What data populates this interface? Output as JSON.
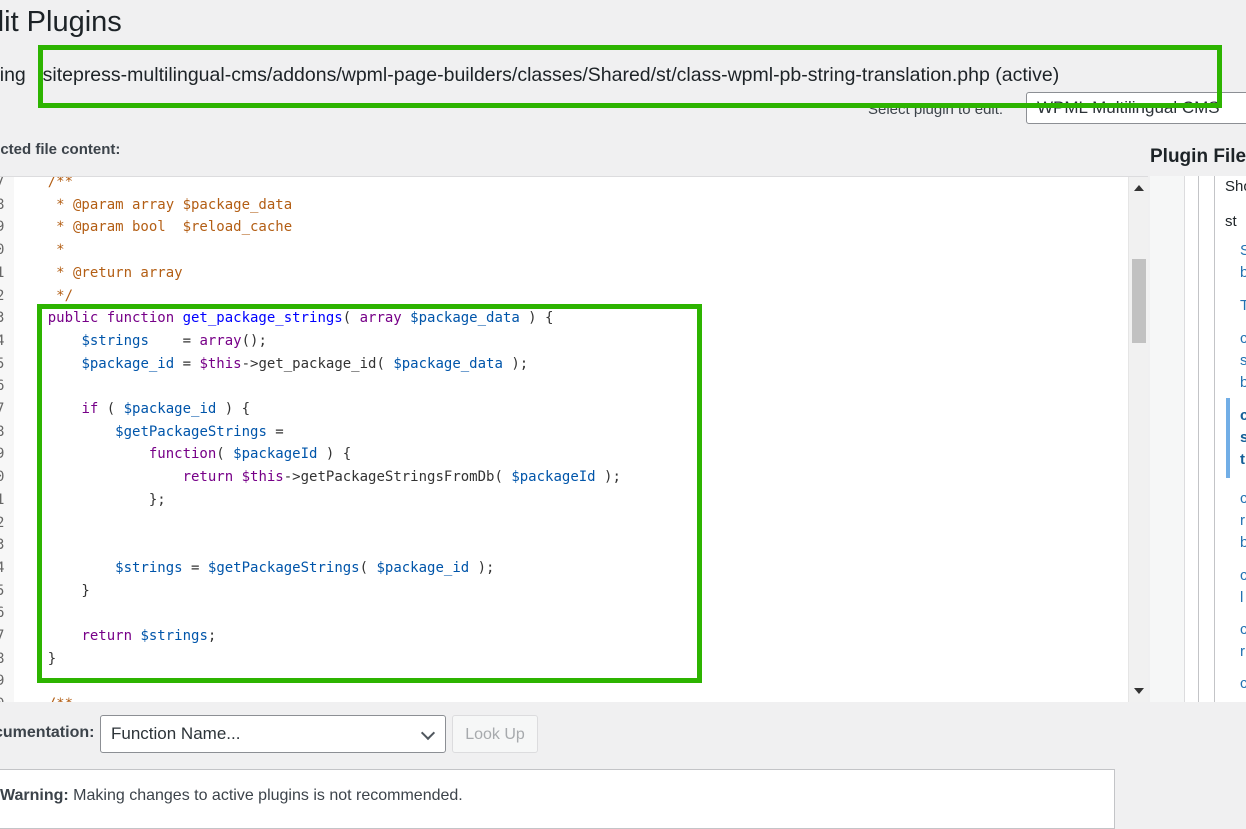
{
  "page_title": "dit Plugins",
  "editing": {
    "prefix": "iting",
    "file_path": "sitepress-multilingual-cms/addons/wpml-page-builders/classes/Shared/st/class-wpml-pb-string-translation.php",
    "status": "(active)"
  },
  "plugin_select": {
    "label": "Select plugin to edit:",
    "value": "WPML Multilingual CMS"
  },
  "selected_file_label": "ected file content:",
  "plugin_files_title": "Plugin File",
  "code_lines": [
    {
      "n": "7",
      "tokens": [
        {
          "t": "    /**",
          "c": "cm"
        }
      ]
    },
    {
      "n": "8",
      "tokens": [
        {
          "t": "     * @param array $package_data",
          "c": "cm"
        }
      ]
    },
    {
      "n": "9",
      "tokens": [
        {
          "t": "     * @param bool  $reload_cache",
          "c": "cm"
        }
      ]
    },
    {
      "n": "0",
      "tokens": [
        {
          "t": "     *",
          "c": "cm"
        }
      ]
    },
    {
      "n": "1",
      "tokens": [
        {
          "t": "     * @return array",
          "c": "cm"
        }
      ]
    },
    {
      "n": "2",
      "tokens": [
        {
          "t": "     */",
          "c": "cm"
        }
      ]
    },
    {
      "n": "3",
      "tokens": [
        {
          "t": "    ",
          "c": ""
        },
        {
          "t": "public function ",
          "c": "kw"
        },
        {
          "t": "get_package_strings",
          "c": "df"
        },
        {
          "t": "( ",
          "c": ""
        },
        {
          "t": "array ",
          "c": "kw"
        },
        {
          "t": "$package_data",
          "c": "vr"
        },
        {
          "t": " ) {",
          "c": ""
        }
      ]
    },
    {
      "n": "4",
      "tokens": [
        {
          "t": "        ",
          "c": ""
        },
        {
          "t": "$strings",
          "c": "vr"
        },
        {
          "t": "    = ",
          "c": ""
        },
        {
          "t": "array",
          "c": "kw"
        },
        {
          "t": "();",
          "c": ""
        }
      ]
    },
    {
      "n": "5",
      "tokens": [
        {
          "t": "        ",
          "c": ""
        },
        {
          "t": "$package_id",
          "c": "vr"
        },
        {
          "t": " = ",
          "c": ""
        },
        {
          "t": "$this",
          "c": "kw"
        },
        {
          "t": "->get_package_id( ",
          "c": ""
        },
        {
          "t": "$package_data",
          "c": "vr"
        },
        {
          "t": " );",
          "c": ""
        }
      ]
    },
    {
      "n": "6",
      "tokens": [
        {
          "t": "",
          "c": ""
        }
      ]
    },
    {
      "n": "7",
      "tokens": [
        {
          "t": "        ",
          "c": ""
        },
        {
          "t": "if",
          "c": "kw"
        },
        {
          "t": " ( ",
          "c": ""
        },
        {
          "t": "$package_id",
          "c": "vr"
        },
        {
          "t": " ) {",
          "c": ""
        }
      ]
    },
    {
      "n": "8",
      "tokens": [
        {
          "t": "            ",
          "c": ""
        },
        {
          "t": "$getPackageStrings",
          "c": "vr"
        },
        {
          "t": " =",
          "c": ""
        }
      ]
    },
    {
      "n": "9",
      "tokens": [
        {
          "t": "                ",
          "c": ""
        },
        {
          "t": "function",
          "c": "kw"
        },
        {
          "t": "( ",
          "c": ""
        },
        {
          "t": "$packageId",
          "c": "vr"
        },
        {
          "t": " ) {",
          "c": ""
        }
      ]
    },
    {
      "n": "0",
      "tokens": [
        {
          "t": "                    ",
          "c": ""
        },
        {
          "t": "return ",
          "c": "kw"
        },
        {
          "t": "$this",
          "c": "kw"
        },
        {
          "t": "->getPackageStringsFromDb( ",
          "c": ""
        },
        {
          "t": "$packageId",
          "c": "vr"
        },
        {
          "t": " );",
          "c": ""
        }
      ]
    },
    {
      "n": "1",
      "tokens": [
        {
          "t": "                };",
          "c": ""
        }
      ]
    },
    {
      "n": "2",
      "tokens": [
        {
          "t": "",
          "c": ""
        }
      ]
    },
    {
      "n": "3",
      "tokens": [
        {
          "t": "",
          "c": ""
        }
      ]
    },
    {
      "n": "4",
      "tokens": [
        {
          "t": "            ",
          "c": ""
        },
        {
          "t": "$strings",
          "c": "vr"
        },
        {
          "t": " = ",
          "c": ""
        },
        {
          "t": "$getPackageStrings",
          "c": "vr"
        },
        {
          "t": "( ",
          "c": ""
        },
        {
          "t": "$package_id",
          "c": "vr"
        },
        {
          "t": " );",
          "c": ""
        }
      ]
    },
    {
      "n": "5",
      "tokens": [
        {
          "t": "        }",
          "c": ""
        }
      ]
    },
    {
      "n": "6",
      "tokens": [
        {
          "t": "",
          "c": ""
        }
      ]
    },
    {
      "n": "7",
      "tokens": [
        {
          "t": "        ",
          "c": ""
        },
        {
          "t": "return ",
          "c": "kw"
        },
        {
          "t": "$strings",
          "c": "vr"
        },
        {
          "t": ";",
          "c": ""
        }
      ]
    },
    {
      "n": "8",
      "tokens": [
        {
          "t": "    }",
          "c": ""
        }
      ]
    },
    {
      "n": "9",
      "tokens": [
        {
          "t": "",
          "c": ""
        }
      ]
    },
    {
      "n": "0",
      "tokens": [
        {
          "t": "    /**",
          "c": "cm"
        }
      ]
    }
  ],
  "file_tree": [
    {
      "text": "Sho",
      "kind": "folder"
    },
    {
      "text": "st",
      "kind": "folder"
    },
    {
      "text": "S",
      "kind": "link"
    },
    {
      "text": "b",
      "kind": "link"
    },
    {
      "text": "T",
      "kind": "link"
    },
    {
      "text": "c",
      "kind": "link"
    },
    {
      "text": "s",
      "kind": "link"
    },
    {
      "text": "b",
      "kind": "link"
    },
    {
      "text": "c",
      "kind": "active"
    },
    {
      "text": "s",
      "kind": "active"
    },
    {
      "text": "t",
      "kind": "active"
    },
    {
      "text": "c",
      "kind": "link"
    },
    {
      "text": "r",
      "kind": "link"
    },
    {
      "text": "b",
      "kind": "link"
    },
    {
      "text": "c",
      "kind": "link"
    },
    {
      "text": "l",
      "kind": "link"
    },
    {
      "text": "c",
      "kind": "link"
    },
    {
      "text": "r",
      "kind": "link"
    },
    {
      "text": "c",
      "kind": "link"
    }
  ],
  "documentation": {
    "label": "cumentation:",
    "placeholder": "Function Name...",
    "lookup_label": "Look Up"
  },
  "warning": {
    "strong": "Warning:",
    "text": " Making changes to active plugins is not recommended."
  },
  "colors": {
    "highlight": "#2db400",
    "link": "#2271b1",
    "background": "#f0f0f1"
  }
}
